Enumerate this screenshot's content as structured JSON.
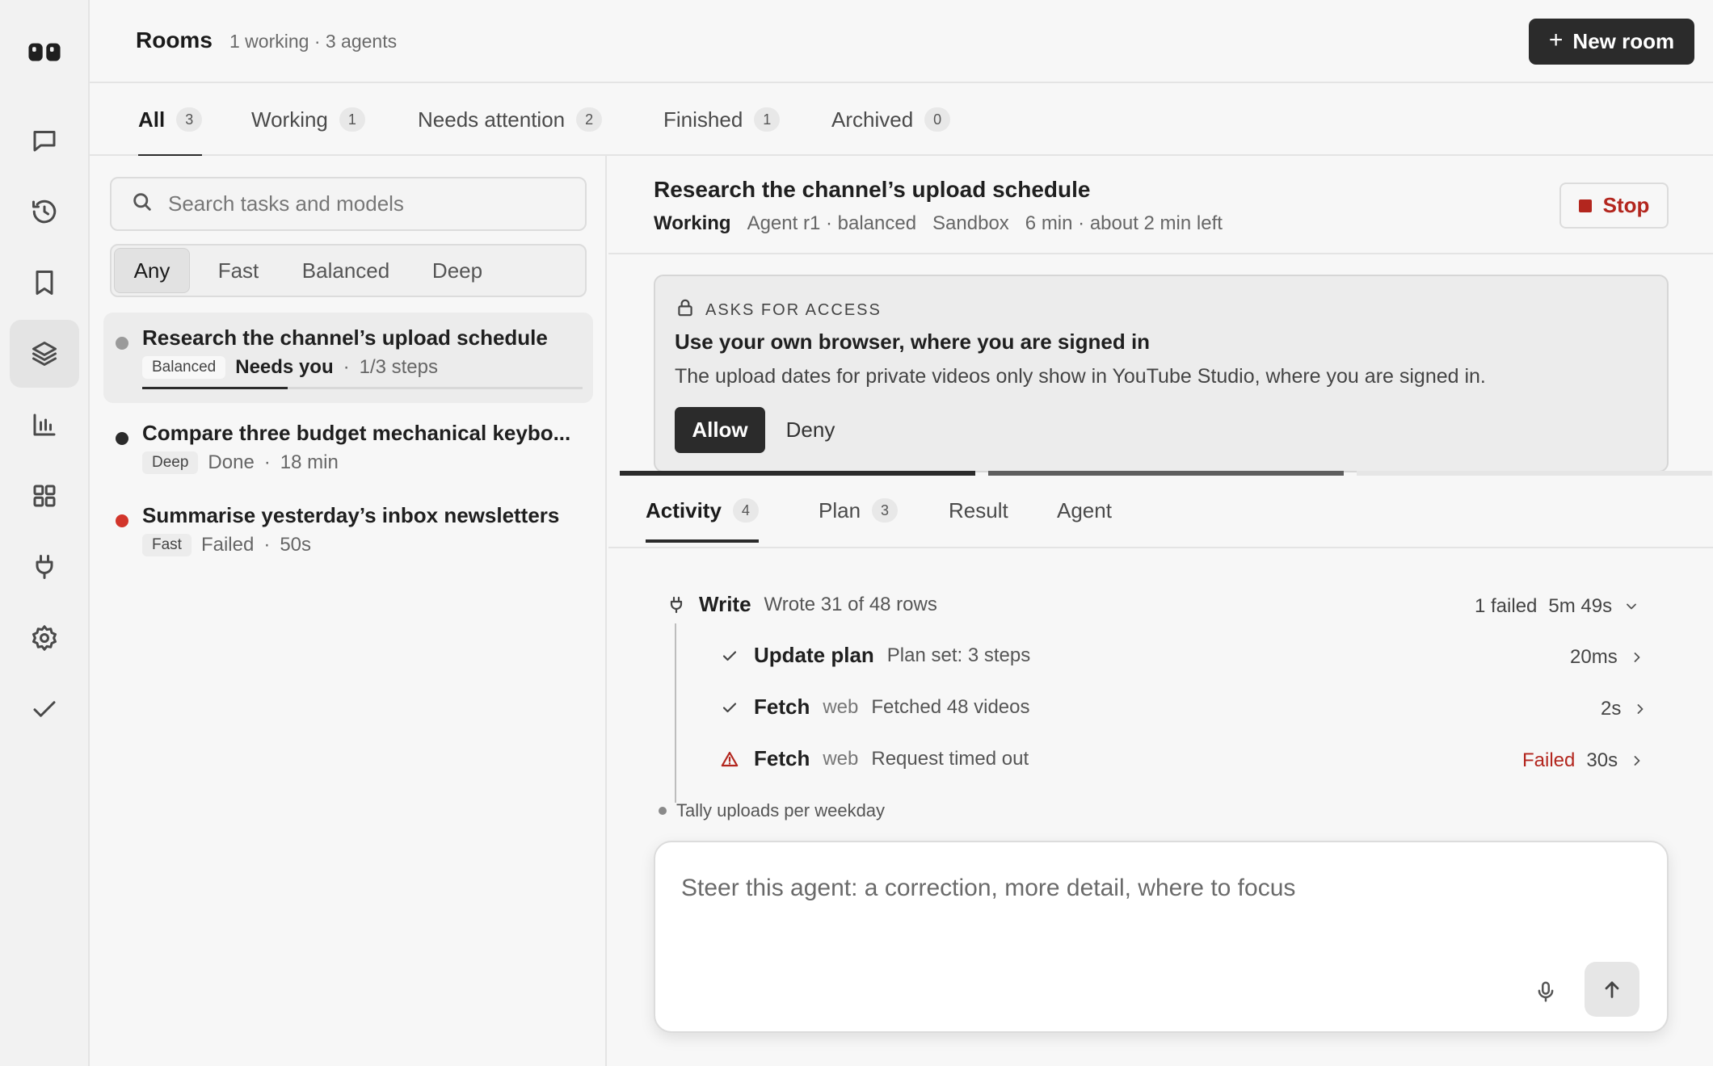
{
  "header": {
    "title": "Rooms",
    "subtitle": "1 working · 3 agents",
    "new_room_plus": "+",
    "new_room_label": "New room"
  },
  "rail": {
    "icons": [
      "logo-icon",
      "chat-icon",
      "history-icon",
      "bookmark-icon",
      "layers-icon",
      "bar-chart-icon",
      "grid-icon",
      "plug-icon",
      "gear-icon",
      "check-icon"
    ],
    "active": "layers-icon"
  },
  "filter_tabs": [
    {
      "label": "All",
      "count": "3"
    },
    {
      "label": "Working",
      "count": "1"
    },
    {
      "label": "Needs attention",
      "count": "2"
    },
    {
      "label": "Finished",
      "count": "1"
    },
    {
      "label": "Archived",
      "count": "0"
    }
  ],
  "search": {
    "placeholder": "Search tasks and models",
    "value": ""
  },
  "model_filter": {
    "options": [
      "Any",
      "Fast",
      "Balanced",
      "Deep"
    ],
    "selected": "Any"
  },
  "tasks": [
    {
      "title": "Research the channel’s upload schedule",
      "model": "Balanced",
      "status": "Needs you",
      "sep": "·",
      "detail": "1/3 steps",
      "dot_color": "#9a9a9a",
      "progress": 0.33
    },
    {
      "title": "Compare three budget mechanical keybo...",
      "model": "Deep",
      "status": "Done",
      "sep": "·",
      "detail": "18 min",
      "dot_color": "#2b2b2b"
    },
    {
      "title": "Summarise yesterday’s inbox newsletters",
      "model": "Fast",
      "status": "Failed",
      "sep": "·",
      "detail": "50s",
      "dot_color": "#d2352b"
    }
  ],
  "detail": {
    "title": "Research the channel’s upload schedule",
    "status": "Working",
    "agent": "Agent r1 · balanced",
    "env": "Sandbox",
    "time": "6 min · about 2 min left",
    "stop_label": "Stop",
    "access": {
      "label": "ASKS FOR ACCESS",
      "title": "Use your own browser, where you are signed in",
      "description": "The upload dates for private videos only show in YouTube Studio, where you are signed in.",
      "allow_label": "Allow",
      "deny_label": "Deny"
    },
    "step_progress": {
      "total": 3,
      "done": 1,
      "current": 2
    },
    "tabs": [
      {
        "label": "Activity",
        "count": "4"
      },
      {
        "label": "Plan",
        "count": "3"
      },
      {
        "label": "Result",
        "count": ""
      },
      {
        "label": "Agent",
        "count": ""
      }
    ],
    "activity": {
      "group": {
        "name": "Write",
        "summary": "Wrote 31 of 48 rows",
        "failed": "1 failed",
        "duration": "5m 49s"
      },
      "items": [
        {
          "state": "done",
          "name": "Update plan",
          "tag": "",
          "summary": "Plan set: 3 steps",
          "status": "",
          "duration": "20ms"
        },
        {
          "state": "done",
          "name": "Fetch",
          "tag": "web",
          "summary": "Fetched 48 videos",
          "status": "",
          "duration": "2s"
        },
        {
          "state": "failed",
          "name": "Fetch",
          "tag": "web",
          "summary": "Request timed out",
          "status": "Failed",
          "duration": "30s"
        }
      ],
      "pending": "Tally uploads per weekday"
    },
    "composer": {
      "placeholder": "Steer this agent: a correction, more detail, where to focus",
      "value": ""
    }
  },
  "colors": {
    "accent": "#2b2b2b",
    "danger": "#b3261e",
    "failed_dot": "#d2352b"
  }
}
